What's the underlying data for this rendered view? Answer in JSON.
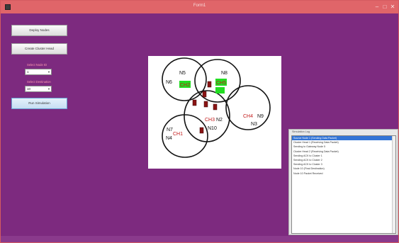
{
  "window": {
    "title": "Form1",
    "minimize": "–",
    "maximize": "□",
    "close": "✕"
  },
  "controls": {
    "deploy_nodes": "Deploy Nodes",
    "create_cluster_head": "Create Cluster Head",
    "label_1": "Select Node ID",
    "select_1": "1",
    "label_2": "Select Destination",
    "select_2": "10",
    "run_simulation": "Run Simulation"
  },
  "network": {
    "node_labels": [
      "N5",
      "N6",
      "N8",
      "N9",
      "N3",
      "N7",
      "N4",
      "N10",
      "N2"
    ],
    "cluster_heads": [
      "CH1",
      "CH2",
      "CH3",
      "CH4",
      "CH5"
    ]
  },
  "log": {
    "title": "Simulation Log",
    "items": [
      "Source Node 1 (Sending Data Packet)",
      "Cluster Head 1 (Receiving Data Packet)",
      "Sending to Gateway Node 5",
      "Cluster Head 2 (Receiving Data Packet)",
      "Sending ACK to Cluster 1",
      "Sending ACK to Cluster 2",
      "Sending ACK to Cluster 3",
      "Node 10 (Final Destination)",
      "Node 10 Packet Received"
    ]
  },
  "colors": {
    "background": "#7d2a7f",
    "titlebar": "#e06569",
    "cluster_head_fill": "#22dd22",
    "node_marker": "#8a1414"
  }
}
